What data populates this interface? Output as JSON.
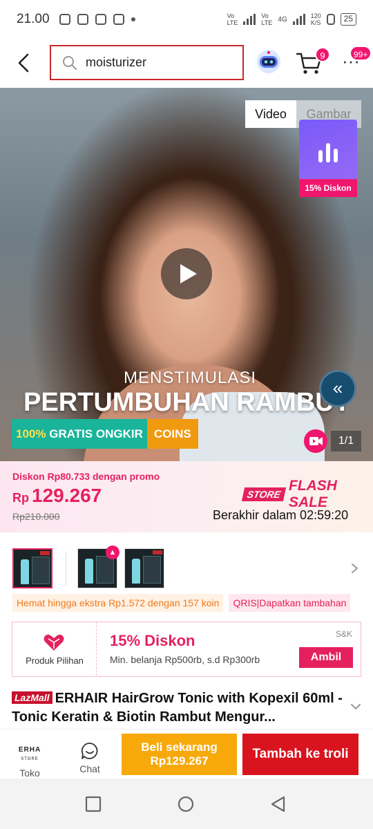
{
  "status_bar": {
    "time": "21.00",
    "net_speed": "120\nK/S",
    "net_1": "Vo\nLTE",
    "net_2": "Vo\nLTE",
    "net_3": "4G",
    "battery": "25"
  },
  "search": {
    "query": "moisturizer"
  },
  "header": {
    "cart_badge": "9",
    "more_badge": "99+"
  },
  "media": {
    "tabs": [
      "Video",
      "Gambar"
    ],
    "active_tab": "Video",
    "promo_widget_label": "15% Diskon",
    "caption_line_1": "MENSTIMULASI",
    "caption_line_2": "PERTUMBUHAN RAMBUT",
    "pill_free_shipping_pct": "100%",
    "pill_free_shipping": "GRATIS ONGKIR",
    "pill_coins": "COINS",
    "counter": "1/1"
  },
  "price": {
    "promo_line": "Diskon Rp80.733 dengan promo",
    "currency": "Rp",
    "current": "129.267",
    "original": "Rp210.000",
    "flash_store": "STORE",
    "flash_label": "FLASH SALE",
    "ends_in": "Berakhir dalam 02:59:20"
  },
  "chips": {
    "coins": "Hemat hingga ekstra Rp1.572 dengan 157 koin",
    "qris": "QRIS|Dapatkan tambahan"
  },
  "voucher": {
    "left_label": "Produk Pilihan",
    "title": "15% Diskon",
    "subtitle": "Min. belanja Rp500rb, s.d Rp300rb",
    "brand": "S&K",
    "cta": "Ambil"
  },
  "product": {
    "badge": "LazMall",
    "title": "ERHAIR HairGrow Tonic with Kopexil 60ml - Tonic Keratin & Biotin Rambut Mengur..."
  },
  "action_bar": {
    "store_logo_1": "ERHA",
    "store_logo_2": "STORE",
    "store_label": "Toko",
    "chat_label": "Chat",
    "buy_label": "Beli sekarang",
    "buy_price": "Rp129.267",
    "cart_label": "Tambah ke troli"
  },
  "colors": {
    "brand_pink": "#e4215e",
    "buy_orange": "#f7a90c",
    "cart_red": "#d9141f"
  }
}
